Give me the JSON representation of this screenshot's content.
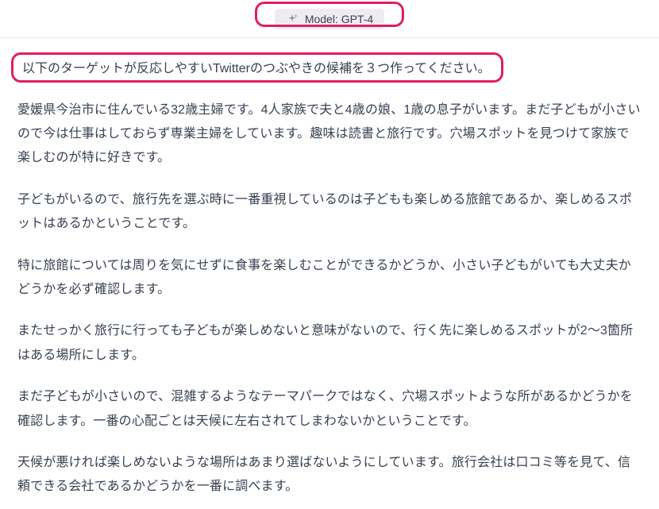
{
  "header": {
    "model_label": "Model: GPT-4",
    "sparkle_icon": "sparkle-icon"
  },
  "prompt": {
    "text": "以下のターゲットが反応しやすいTwitterのつぶやきの候補を３つ作ってください。"
  },
  "body": {
    "paragraphs": [
      "愛媛県今治市に住んでいる32歳主婦です。4人家族で夫と4歳の娘、1歳の息子がいます。まだ子どもが小さいので今は仕事はしておらず専業主婦をしています。趣味は読書と旅行です。穴場スポットを見つけて家族で楽しむのが特に好きです。",
      "子どもがいるので、旅行先を選ぶ時に一番重視しているのは子どもも楽しめる旅館であるか、楽しめるスポットはあるかということです。",
      "特に旅館については周りを気にせずに食事を楽しむことができるかどうか、小さい子どもがいても大丈夫かどうかを必ず確認します。",
      "またせっかく旅行に行っても子どもが楽しめないと意味がないので、行く先に楽しめるスポットが2〜3箇所はある場所にします。",
      "まだ子どもが小さいので、混雑するようなテーマパークではなく、穴場スポットような所があるかどうかを確認します。一番の心配ごとは天候に左右されてしまわないかということです。",
      "天候が悪ければ楽しめないような場所はあまり選ばないようにしています。旅行会社は口コミ等を見て、信頼できる会社であるかどうかを一番に調べます。"
    ]
  },
  "annotations": {
    "highlight_color": "#e11d66"
  }
}
